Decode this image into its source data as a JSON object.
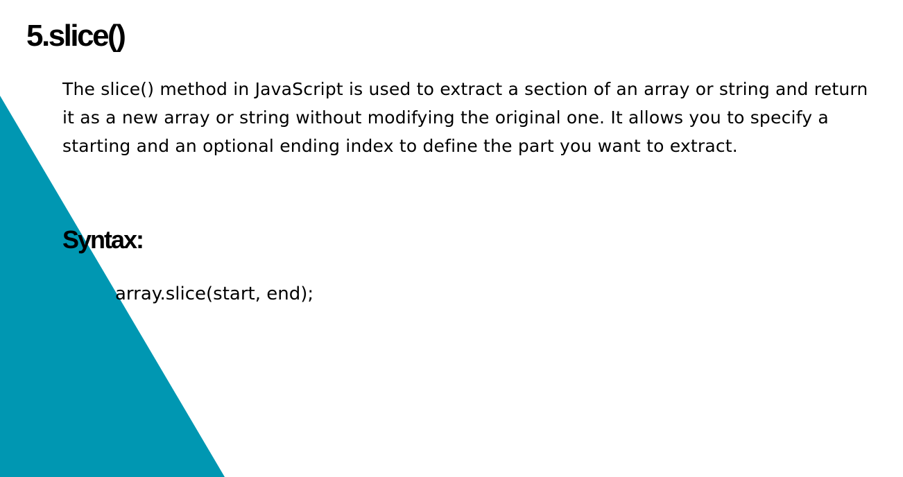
{
  "slide": {
    "title": "5.slice()",
    "description": "The slice() method in JavaScript is used to extract a section of an array or string and return it as a new array or string without modifying the original one. It allows you to specify a starting and an optional ending index to define the part you want to extract.",
    "syntax_heading": "Syntax:",
    "syntax_code": "array.slice(start, end);"
  },
  "colors": {
    "accent": "#0097b2",
    "text": "#000000",
    "background": "#ffffff"
  }
}
